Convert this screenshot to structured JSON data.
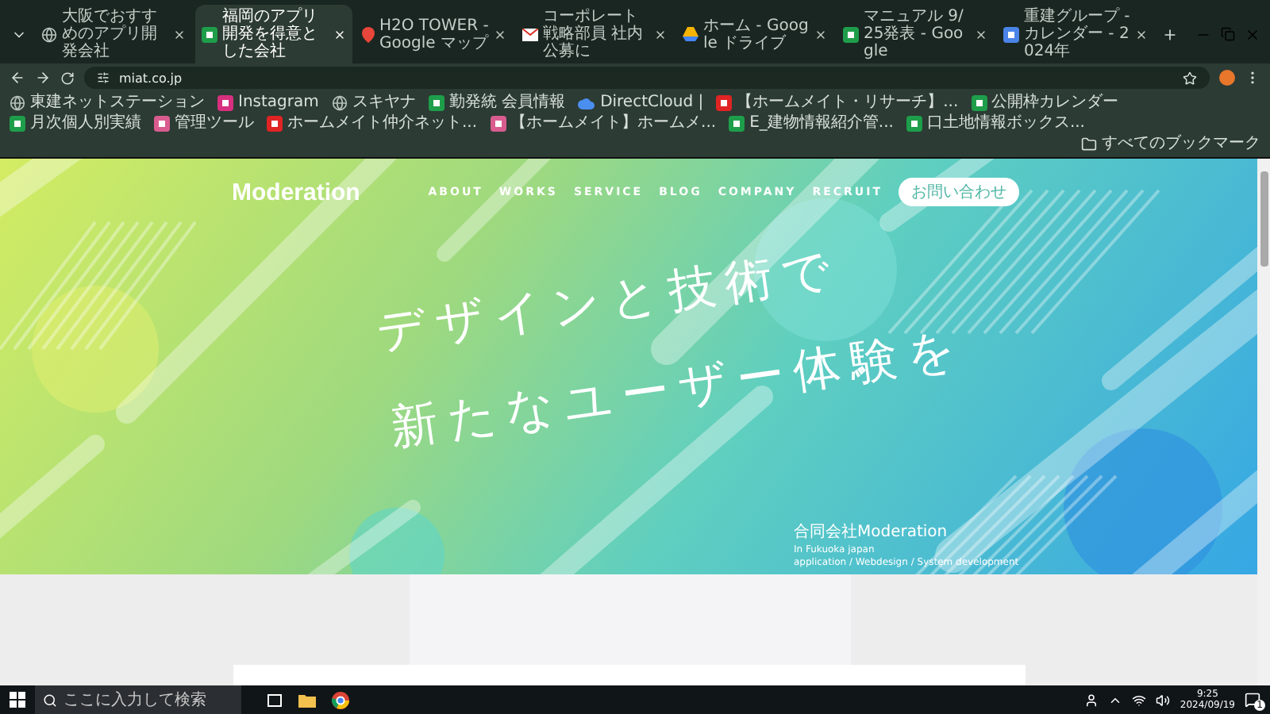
{
  "browser": {
    "tabs": [
      {
        "title": "大阪でおすすめのアプリ開発会社",
        "selected": false,
        "kind": "globe"
      },
      {
        "title": "福岡のアプリ開発を得意とした会社",
        "selected": true,
        "kind": "sheet"
      },
      {
        "title": "H2O TOWER - Google マップ",
        "selected": false,
        "kind": "map"
      },
      {
        "title": "コーポレート戦略部員 社内公募に",
        "selected": false,
        "kind": "mail"
      },
      {
        "title": "ホーム - Google ドライブ",
        "selected": false,
        "kind": "drive"
      },
      {
        "title": "マニュアル 9/25発表 - Google",
        "selected": false,
        "kind": "sheet"
      },
      {
        "title": "重建グループ - カレンダー - 2024年",
        "selected": false,
        "kind": "calendar"
      }
    ],
    "address": "miat.co.jp",
    "bookmarks": [
      {
        "label": "東建ネットステーション",
        "kind": "globe"
      },
      {
        "label": "Instagram",
        "kind": "instagram"
      },
      {
        "label": "スキヤナ",
        "kind": "globe"
      },
      {
        "label": "勤発統 会員情報",
        "kind": "sheet"
      },
      {
        "label": "DirectCloud |",
        "kind": "cloud"
      },
      {
        "label": "【ホームメイト・リサーチ】...",
        "kind": "h"
      },
      {
        "label": "公開枠カレンダー",
        "kind": "sheet"
      },
      {
        "label": "月次個人別実績",
        "kind": "sheet"
      },
      {
        "label": "管理ツール",
        "kind": "pink"
      },
      {
        "label": "ホームメイト仲介ネット...",
        "kind": "h"
      },
      {
        "label": "【ホームメイト】ホームメ...",
        "kind": "pink"
      },
      {
        "label": "E_建物情報紹介管...",
        "kind": "sheet"
      },
      {
        "label": "口土地情報ボックス...",
        "kind": "sheet"
      }
    ],
    "all_bookmarks": "すべてのブックマーク"
  },
  "page": {
    "logo": "Moderation",
    "nav": [
      "ABOUT",
      "WORKS",
      "SERVICE",
      "BLOG",
      "COMPANY",
      "RECRUIT"
    ],
    "contact_button": "お問い合わせ",
    "headline": [
      "デザインと技術で",
      "新たなユーザー体験を"
    ],
    "company_lines": [
      "合同会社Moderation",
      "In Fukuoka japan",
      "application / Webdesign / System development"
    ]
  },
  "taskbar": {
    "search_placeholder": "ここに入力して検索",
    "time": "9:25",
    "date": "2024/09/19",
    "notification_count": "1"
  }
}
